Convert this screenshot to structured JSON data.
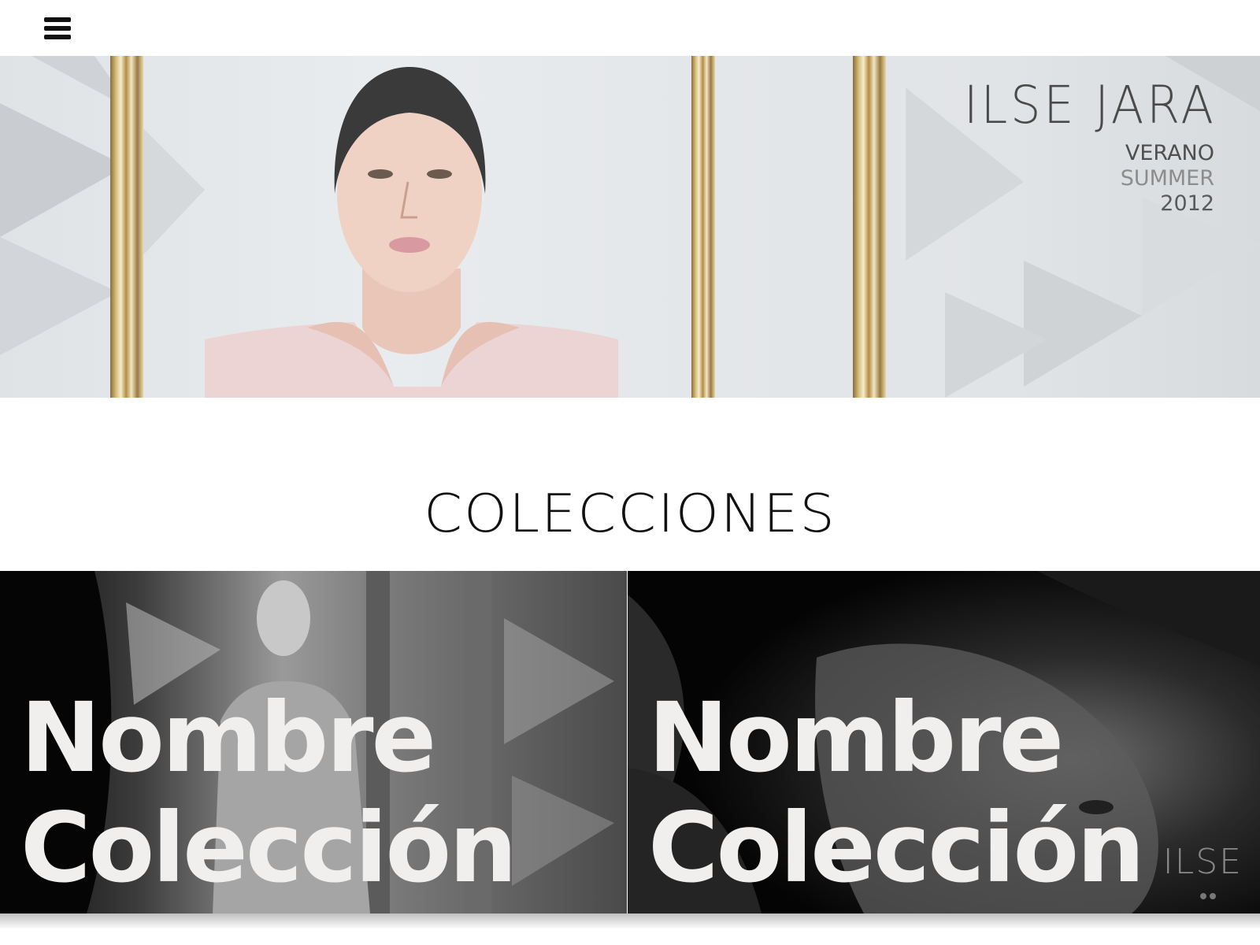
{
  "header": {
    "menu_icon": "hamburger-menu-icon"
  },
  "hero": {
    "brand_name": "ILSE JARA",
    "season_es": "VERANO",
    "season_en": "SUMMER",
    "year": "2012"
  },
  "section": {
    "title": "COLECCIONES"
  },
  "collections": [
    {
      "title_line1": "Nombre",
      "title_line2": "Colección"
    },
    {
      "title_line1": "Nombre",
      "title_line2": "Colección",
      "watermark": "ILSE"
    }
  ],
  "colors": {
    "background": "#ffffff",
    "text_dark": "#111111",
    "card_title": "#f1eeee",
    "frame_gold": "#c9a85c"
  }
}
